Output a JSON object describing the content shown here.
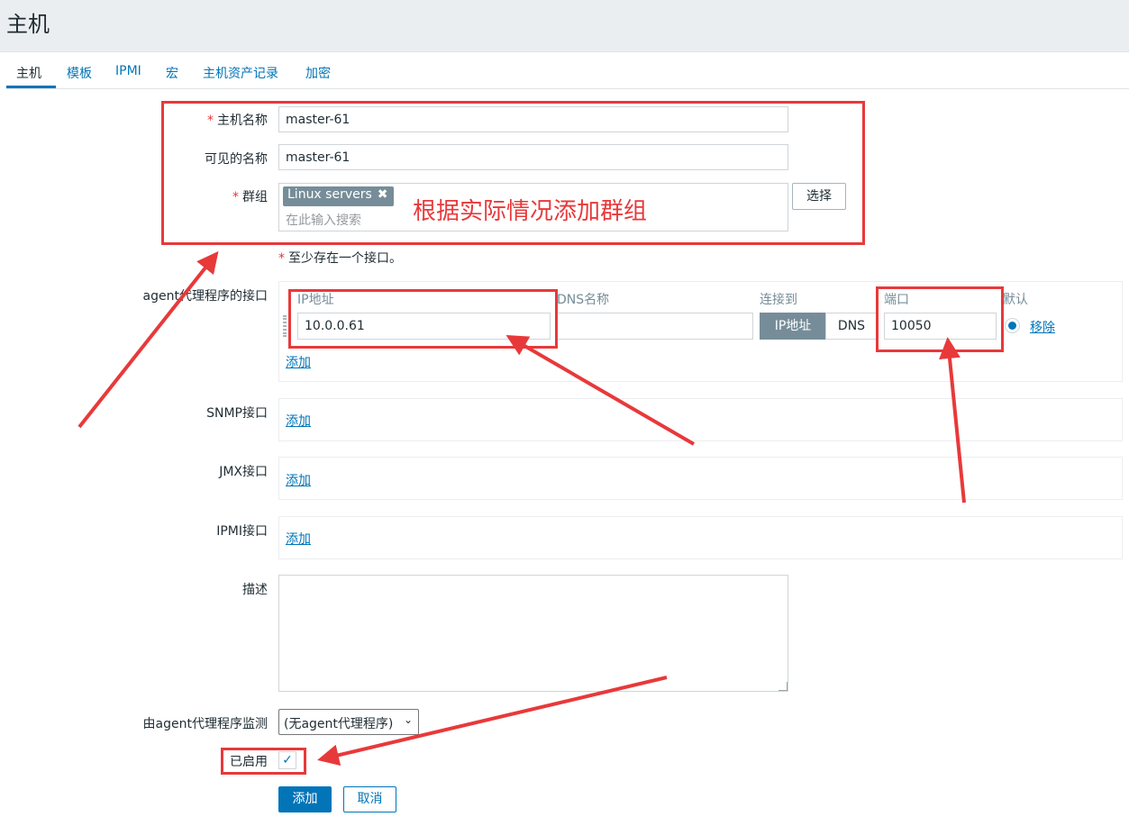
{
  "page": {
    "title": "主机"
  },
  "tabs": [
    {
      "label": "主机"
    },
    {
      "label": "模板"
    },
    {
      "label": "IPMI"
    },
    {
      "label": "宏"
    },
    {
      "label": "主机资产记录"
    },
    {
      "label": "加密"
    }
  ],
  "form": {
    "required_mark": "*",
    "host_name": {
      "label": "主机名称",
      "value": "master-61"
    },
    "visible_name": {
      "label": "可见的名称",
      "value": "master-61"
    },
    "groups": {
      "label": "群组",
      "chip": "Linux servers",
      "chip_remove": "✖",
      "search_placeholder": "在此输入搜索",
      "select_button": "选择"
    },
    "interface_note": "至少存在一个接口。",
    "agent_interfaces": {
      "label": "agent代理程序的接口",
      "columns": {
        "ip": "IP地址",
        "dns": "DNS名称",
        "connect_to": "连接到",
        "port": "端口",
        "default": "默认"
      },
      "row": {
        "ip": "10.0.0.61",
        "dns": "",
        "connect_ip": "IP地址",
        "connect_dns": "DNS",
        "port": "10050",
        "remove": "移除"
      },
      "add": "添加"
    },
    "snmp": {
      "label": "SNMP接口",
      "add": "添加"
    },
    "jmx": {
      "label": "JMX接口",
      "add": "添加"
    },
    "ipmi": {
      "label": "IPMI接口",
      "add": "添加"
    },
    "description": {
      "label": "描述",
      "value": ""
    },
    "proxy": {
      "label": "由agent代理程序监测",
      "value": "(无agent代理程序)"
    },
    "enabled": {
      "label": "已启用",
      "check": "✓"
    },
    "buttons": {
      "add": "添加",
      "cancel": "取消"
    }
  },
  "annotation": {
    "text": "根据实际情况添加群组",
    "color": "#e8393a"
  },
  "colors": {
    "accent": "#0275b8",
    "chip": "#768d99",
    "background": "#ebeef0"
  }
}
